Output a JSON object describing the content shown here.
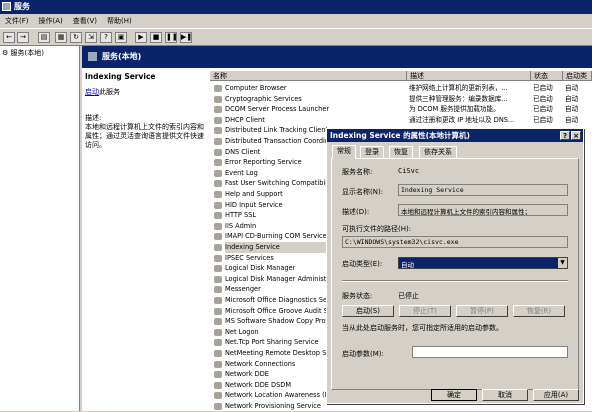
{
  "window": {
    "title": "服务"
  },
  "menu": [
    "文件(F)",
    "操作(A)",
    "查看(V)",
    "帮助(H)"
  ],
  "tree": {
    "root": "服务(本地)"
  },
  "main": {
    "header": "服务(本地)"
  },
  "desc": {
    "title": "Indexing Service",
    "start_link": "启动",
    "start_suffix": "此服务",
    "label": "描述:",
    "text": "本地和远程计算机上文件的索引内容和属性；通过灵活查询语言提供文件快速访问。"
  },
  "list": {
    "headers": [
      "名称",
      "描述",
      "状态",
      "启动类"
    ],
    "rows": [
      {
        "name": "Computer Browser",
        "desc": "维护网络上计算机的更新列表，...",
        "status": "已启动",
        "startup": "自动"
      },
      {
        "name": "Cryptographic Services",
        "desc": "提供三种管理服务：编录数据库...",
        "status": "已启动",
        "startup": "自动"
      },
      {
        "name": "DCOM Server Process Launcher",
        "desc": "为 DCOM 服务提供加载功能。",
        "status": "已启动",
        "startup": "自动"
      },
      {
        "name": "DHCP Client",
        "desc": "通过注册和更改 IP 地址以及 DNS...",
        "status": "已启动",
        "startup": "自动"
      },
      {
        "name": "Distributed Link Tracking Client",
        "desc": "",
        "status": "",
        "startup": ""
      },
      {
        "name": "Distributed Transaction Coordina",
        "desc": "",
        "status": "",
        "startup": ""
      },
      {
        "name": "DNS Client",
        "desc": "",
        "status": "",
        "startup": ""
      },
      {
        "name": "Error Reporting Service",
        "desc": "",
        "status": "",
        "startup": ""
      },
      {
        "name": "Event Log",
        "desc": "",
        "status": "",
        "startup": ""
      },
      {
        "name": "Fast User Switching Compatibility",
        "desc": "",
        "status": "",
        "startup": ""
      },
      {
        "name": "Help and Support",
        "desc": "",
        "status": "",
        "startup": ""
      },
      {
        "name": "HID Input Service",
        "desc": "",
        "status": "",
        "startup": ""
      },
      {
        "name": "HTTP SSL",
        "desc": "",
        "status": "",
        "startup": ""
      },
      {
        "name": "IIS Admin",
        "desc": "",
        "status": "",
        "startup": ""
      },
      {
        "name": "IMAPI CD-Burning COM Service",
        "desc": "",
        "status": "",
        "startup": ""
      },
      {
        "name": "Indexing Service",
        "desc": "",
        "status": "",
        "startup": ""
      },
      {
        "name": "IPSEC Services",
        "desc": "",
        "status": "",
        "startup": ""
      },
      {
        "name": "Logical Disk Manager",
        "desc": "",
        "status": "",
        "startup": ""
      },
      {
        "name": "Logical Disk Manager Administrat",
        "desc": "",
        "status": "",
        "startup": ""
      },
      {
        "name": "Messenger",
        "desc": "",
        "status": "",
        "startup": ""
      },
      {
        "name": "Microsoft Office Diagnostics Serv",
        "desc": "",
        "status": "",
        "startup": ""
      },
      {
        "name": "Microsoft Office Groove Audit Se",
        "desc": "",
        "status": "",
        "startup": ""
      },
      {
        "name": "MS Software Shadow Copy Provi",
        "desc": "",
        "status": "",
        "startup": ""
      },
      {
        "name": "Net Logon",
        "desc": "",
        "status": "",
        "startup": ""
      },
      {
        "name": "Net.Tcp Port Sharing Service",
        "desc": "",
        "status": "",
        "startup": ""
      },
      {
        "name": "NetMeeting Remote Desktop Sha",
        "desc": "",
        "status": "",
        "startup": ""
      },
      {
        "name": "Network Connections",
        "desc": "",
        "status": "",
        "startup": ""
      },
      {
        "name": "Network DDE",
        "desc": "",
        "status": "",
        "startup": ""
      },
      {
        "name": "Network DDE DSDM",
        "desc": "",
        "status": "",
        "startup": ""
      },
      {
        "name": "Network Location Awareness (NL",
        "desc": "",
        "status": "",
        "startup": ""
      },
      {
        "name": "Network Provisioning Service",
        "desc": "",
        "status": "",
        "startup": ""
      }
    ]
  },
  "dialog": {
    "title": "Indexing Service 的属性(本地计算机)",
    "help": "?",
    "close": "×",
    "tabs": [
      "常规",
      "登录",
      "恢复",
      "依存关系"
    ],
    "service_name_label": "服务名称:",
    "service_name": "CiSvc",
    "display_name_label": "显示名称(N):",
    "display_name": "Indexing Service",
    "description_label": "描述(D):",
    "description": "本地和远程计算机上文件的索引内容和属性；",
    "exe_label": "可执行文件的路径(H):",
    "exe_path": "C:\\WINDOWS\\system32\\cisvc.exe",
    "startup_label": "启动类型(E):",
    "startup_value": "自动",
    "status_label": "服务状态:",
    "status_value": "已停止",
    "btn_start": "启动(S)",
    "btn_stop": "停止(T)",
    "btn_pause": "暂停(P)",
    "btn_resume": "恢复(R)",
    "hint": "当从此处启动服务时，您可指定所适用的启动参数。",
    "params_label": "启动参数(M):",
    "ok": "确定",
    "cancel": "取消",
    "apply": "应用(A)"
  }
}
